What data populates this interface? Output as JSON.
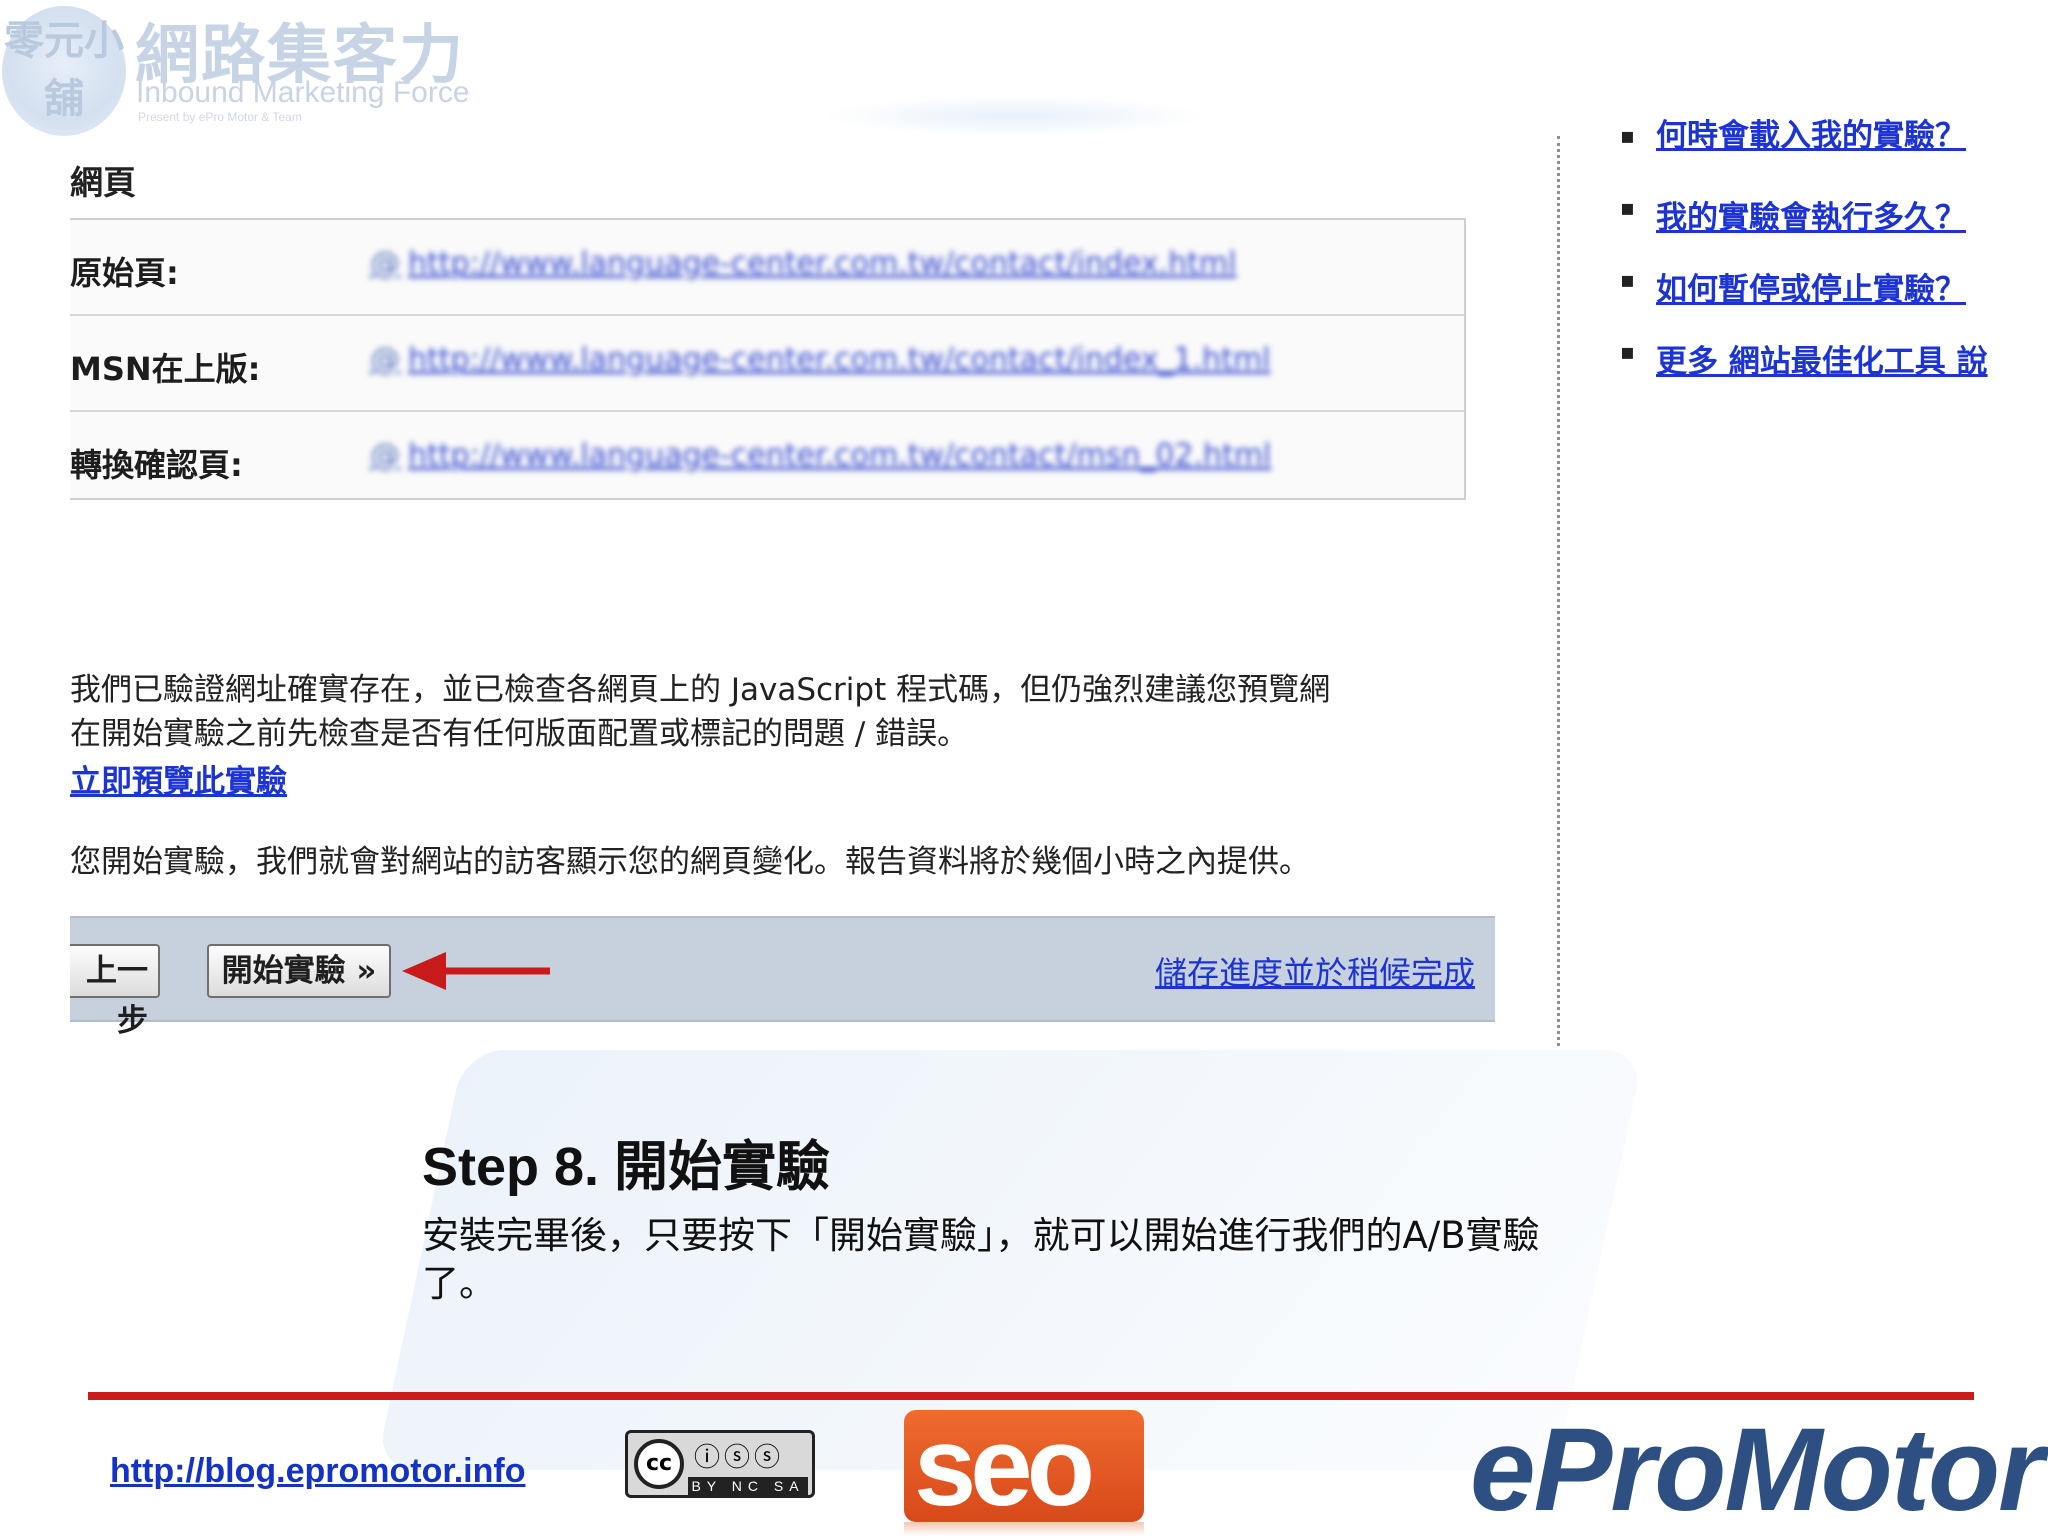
{
  "logo": {
    "badge_text": "零元小舖",
    "title": "網路集客力",
    "subtitle": "Inbound Marketing Force",
    "tagline": "Present by ePro Motor & Team"
  },
  "screenshot": {
    "heading": "網頁",
    "url_rows": [
      {
        "label": "原始頁:",
        "url": "http://www.language-center.com.tw/contact/index.html"
      },
      {
        "label": "MSN在上版:",
        "url": "http://www.language-center.com.tw/contact/index_1.html"
      },
      {
        "label": "轉換確認頁:",
        "url": "http://www.language-center.com.tw/contact/msn_02.html"
      }
    ],
    "para1_line1": "我們已驗證網址確實存在，並已檢查各網頁上的 JavaScript 程式碼，但仍強烈建議您預覽網",
    "para1_line2": "在開始實驗之前先檢查是否有任何版面配置或標記的問題 / 錯誤。",
    "preview_link": "立即預覽此實驗",
    "para2": "您開始實驗，我們就會對網站的訪客顯示您的網頁變化。報告資料將於幾個小時之內提供。",
    "back_button": "上一步",
    "start_button": "開始實驗 »",
    "save_link": "儲存進度並於稍候完成",
    "faq_items": [
      "何時會載入我的實驗？",
      "我的實驗會執行多久？",
      "如何暫停或停止實驗？",
      "更多 網站最佳化工具 說"
    ]
  },
  "step": {
    "title": "Step 8. 開始實驗",
    "description": "安裝完畢後，只要按下「開始實驗」，就可以開始進行我們的A/B實驗了。"
  },
  "footer": {
    "url": "http://blog.epromotor.info",
    "cc_license": "BY NC SA",
    "seo_text": "seo",
    "brand": "eProMotor"
  },
  "colors": {
    "link": "#1c33d6",
    "action_bar": "#c7d1dd",
    "rule": "#cc1b1b",
    "brand": "#2d4f82",
    "seo": "#e2571f"
  }
}
